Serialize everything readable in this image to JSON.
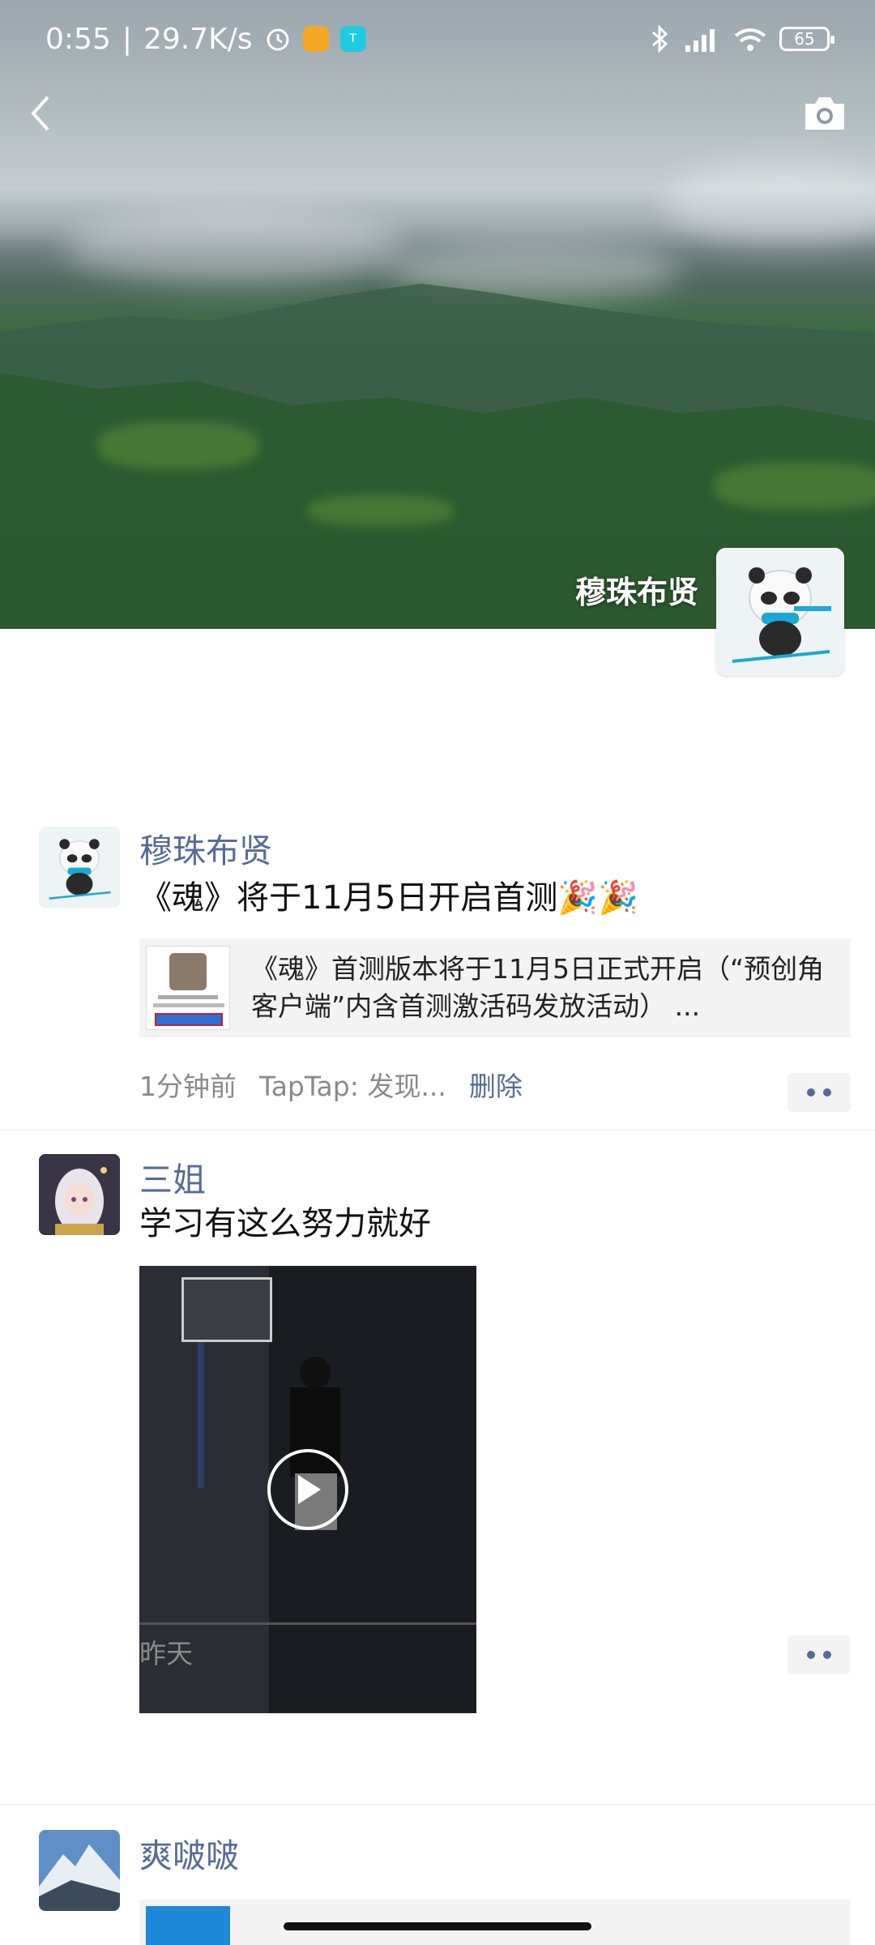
{
  "status_bar": {
    "time": "0:55",
    "separator": "|",
    "speed": "29.7K/s",
    "battery": "65",
    "icons": [
      "alarm-icon",
      "message-app-icon",
      "taptap-app-icon",
      "bluetooth-icon",
      "signal-hd-icon",
      "wifi-icon",
      "battery-icon"
    ]
  },
  "nav": {
    "back_icon": "chevron-left-icon",
    "camera_icon": "camera-icon"
  },
  "profile": {
    "name": "穆珠布贤"
  },
  "posts": [
    {
      "author": "穆珠布贤",
      "text": "《魂》将于11月5日开启首测🎉🎉",
      "link": {
        "line1": "《魂》首测版本将于11月5日正式开启（“预创角",
        "line2": "客户端”内含首测激活码发放活动）  ..."
      },
      "time": "1分钟前",
      "source": "TapTap: 发现...",
      "delete": "删除"
    },
    {
      "author": "三姐",
      "text": "学习有这么努力就好",
      "media": "video",
      "time": "昨天"
    },
    {
      "author": "爽啵啵"
    }
  ],
  "colors": {
    "link_blue": "#576b95",
    "meta_gray": "#8a8a8a",
    "card_bg": "#f3f3f3"
  }
}
